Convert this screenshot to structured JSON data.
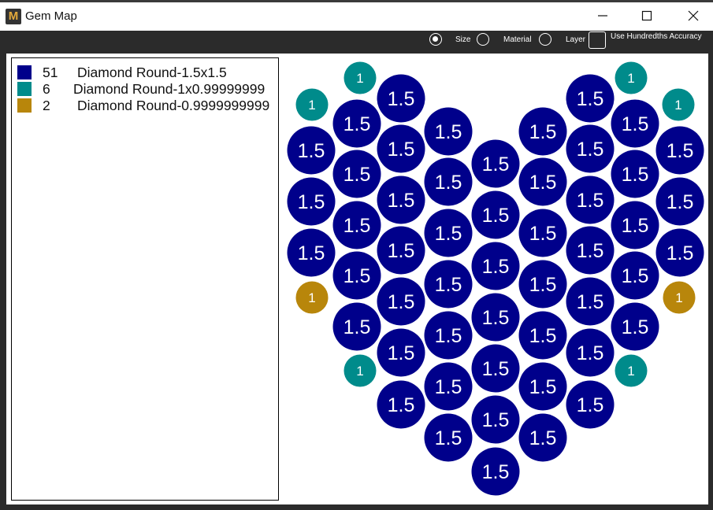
{
  "window": {
    "title": "Gem Map",
    "app_icon_letter": "M"
  },
  "toolbar": {
    "options": [
      {
        "label": "Size",
        "selected": true
      },
      {
        "label": "Material",
        "selected": false
      },
      {
        "label": "Layer",
        "selected": false
      }
    ],
    "hundredths_label": "Use Hundredths Accuracy",
    "hundredths_checked": false
  },
  "legend": {
    "items": [
      {
        "count": "51",
        "name": "Diamond Round-1.5x1.5",
        "color": "#00008b"
      },
      {
        "count": "6",
        "name": "Diamond Round-1x0.99999999",
        "color": "#008b8b"
      },
      {
        "count": "2",
        "name": "Diamond Round-0.9999999999",
        "color": "#b8860b"
      }
    ]
  },
  "gem_map": {
    "colors": {
      "large": "#00008b",
      "teal": "#008b8b",
      "gold": "#b8860b"
    },
    "large_label": "1.5",
    "small_label": "1",
    "columns": [
      {
        "type": "large",
        "rows": [
          0.0,
          0.5,
          1.0,
          1.5,
          2.0,
          2.5,
          3.0,
          3.5,
          4.0,
          4.5,
          5.0,
          5.5,
          6.0,
          6.5
        ]
      }
    ]
  }
}
